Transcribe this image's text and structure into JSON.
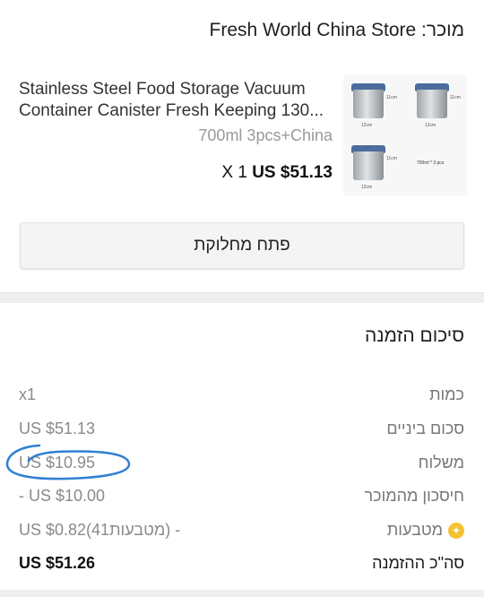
{
  "seller": {
    "label": "מוכר:",
    "name": "Fresh World China Store",
    "text": "מוכר: Fresh World China Store"
  },
  "product": {
    "title_line1": "Stainless Steel Food Storage Vacuum",
    "title_line2": "Container Canister Fresh Keeping 130...",
    "variant": "700ml 3pcs+China",
    "quantity": "X 1",
    "price": "US $51.13",
    "thumbnail": {
      "dim_height": "11cm",
      "dim_width": "12cm",
      "spec": "700ml * 3 pcs"
    }
  },
  "dispute_button": {
    "label": "פתח מחלוקת"
  },
  "summary": {
    "title": "סיכום הזמנה",
    "rows": [
      {
        "label": "כמות",
        "value": "x1"
      },
      {
        "label": "סכום ביניים",
        "value": "US $51.13"
      },
      {
        "label": "משלוח",
        "value": "US $10.95"
      },
      {
        "label": "חיסכון מהמוכר",
        "value": "- US $10.00"
      },
      {
        "label": "מטבעות",
        "value": "US $0.82(41מטבעות) -",
        "icon": "coin-icon"
      },
      {
        "label": "סה\"כ ההזמנה",
        "value": "US $51.26"
      }
    ]
  },
  "colors": {
    "accent_coin": "#f5c233",
    "annotation_stroke": "#2f7fd3",
    "lid_blue": "#4b6d9e"
  }
}
